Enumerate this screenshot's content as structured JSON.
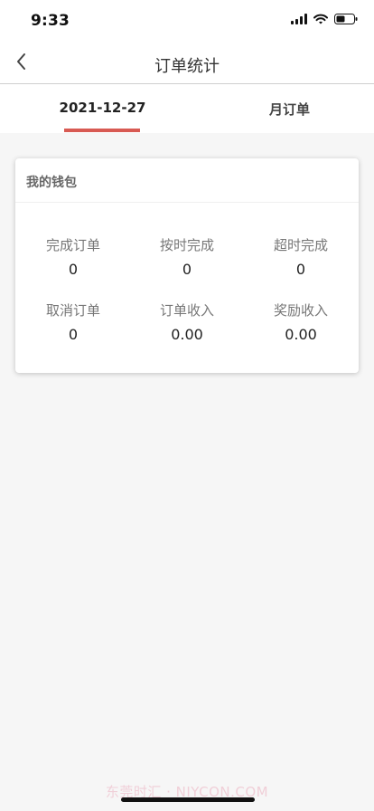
{
  "status_bar": {
    "time": "9:33",
    "icons": [
      "cellular-signal-icon",
      "wifi-icon",
      "battery-icon"
    ]
  },
  "nav": {
    "back_icon": "chevron-left-icon",
    "title": "订单统计"
  },
  "tabs": [
    {
      "label": "2021-12-27",
      "active": true
    },
    {
      "label": "月订单",
      "active": false
    }
  ],
  "wallet": {
    "title": "我的钱包",
    "stats": [
      {
        "label": "完成订单",
        "value": "0"
      },
      {
        "label": "按时完成",
        "value": "0"
      },
      {
        "label": "超时完成",
        "value": "0"
      },
      {
        "label": "取消订单",
        "value": "0"
      },
      {
        "label": "订单收入",
        "value": "0.00"
      },
      {
        "label": "奖励收入",
        "value": "0.00"
      }
    ]
  },
  "watermark": "东莞时汇 · NIYCON.COM",
  "colors": {
    "accent": "#d85a53",
    "background": "#f6f6f6"
  }
}
